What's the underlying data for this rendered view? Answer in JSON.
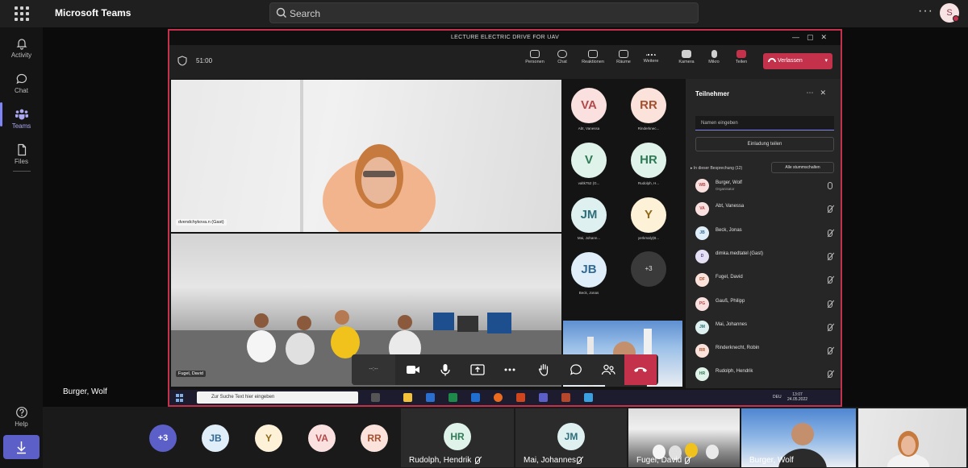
{
  "app": {
    "title": "Microsoft Teams"
  },
  "search": {
    "placeholder": "Search"
  },
  "user": {
    "initial": "S"
  },
  "rail": {
    "items": [
      {
        "label": "Activity",
        "icon": "bell-icon"
      },
      {
        "label": "Chat",
        "icon": "chat-icon"
      },
      {
        "label": "Teams",
        "icon": "teams-icon"
      },
      {
        "label": "Files",
        "icon": "file-icon"
      }
    ],
    "help": "Help"
  },
  "stage": {
    "participant_name": "Burger, Wolf"
  },
  "shared_screen": {
    "window_title": "LECTURE ELECTRIC DRIVE FOR UAV",
    "timer": "51:00",
    "toolbar": [
      {
        "label": "Personen"
      },
      {
        "label": "Chat"
      },
      {
        "label": "Reaktionen"
      },
      {
        "label": "Räume"
      },
      {
        "label": "Weitere"
      },
      {
        "label": "Kamera"
      },
      {
        "label": "Mikro"
      },
      {
        "label": "Teilen"
      }
    ],
    "leave_label": "Verlassen",
    "tile1_name": "dvendchykova.n (Gast)",
    "tile2_name": "Fugel, David",
    "grid": [
      {
        "initials": "VA",
        "name": "Abt, Vanessa",
        "bg": "#fbe0e0",
        "fg": "#b34a4a"
      },
      {
        "initials": "RR",
        "name": "Rinderknec...",
        "bg": "#fbe3dc",
        "fg": "#a4502e"
      },
      {
        "initials": "V",
        "name": "valtk752 (G...",
        "bg": "#dff3ea",
        "fg": "#2e7a55"
      },
      {
        "initials": "HR",
        "name": "Rudolph, H...",
        "bg": "#dff3ea",
        "fg": "#2e7a55"
      },
      {
        "initials": "JM",
        "name": "Mai, Johann...",
        "bg": "#dff0f0",
        "fg": "#2d6e7a"
      },
      {
        "initials": "Y",
        "name": "yerkmaly(B...",
        "bg": "#fdf1d8",
        "fg": "#8f6a1a"
      },
      {
        "initials": "JB",
        "name": "Beck, Jonas",
        "bg": "#dfeef8",
        "fg": "#336a94"
      }
    ],
    "more_count": "+3",
    "panel": {
      "title": "Teilnehmer",
      "search_placeholder": "Namen eingeben",
      "invite_label": "Einladung teilen",
      "section_label": "In dieser Besprechung (12)",
      "mute_all_label": "Alle stummschalten",
      "participants": [
        {
          "initials": "WB",
          "name": "Burger, Wolf",
          "sub": "Organisator",
          "bg": "#fbe0e0",
          "fg": "#b34a4a",
          "mic": "on"
        },
        {
          "initials": "VA",
          "name": "Abt, Vanessa",
          "sub": "",
          "bg": "#fbe0e0",
          "fg": "#b34a4a",
          "mic": "off"
        },
        {
          "initials": "JB",
          "name": "Beck, Jonas",
          "sub": "",
          "bg": "#dfeef8",
          "fg": "#336a94",
          "mic": "off"
        },
        {
          "initials": "D",
          "name": "dimka.medtatel (Gast)",
          "sub": "",
          "bg": "#e6e0f5",
          "fg": "#5a4a94",
          "mic": "off"
        },
        {
          "initials": "DF",
          "name": "Fugel, David",
          "sub": "",
          "bg": "#fbe3dc",
          "fg": "#a4502e",
          "mic": "off"
        },
        {
          "initials": "PG",
          "name": "Gauß, Philipp",
          "sub": "",
          "bg": "#fbe0e0",
          "fg": "#b34a4a",
          "mic": "off"
        },
        {
          "initials": "JM",
          "name": "Mai, Johannes",
          "sub": "",
          "bg": "#dff0f0",
          "fg": "#2d6e7a",
          "mic": "off"
        },
        {
          "initials": "RR",
          "name": "Rinderknecht, Robin",
          "sub": "",
          "bg": "#fbe3dc",
          "fg": "#a4502e",
          "mic": "off"
        },
        {
          "initials": "HR",
          "name": "Rudolph, Hendrik",
          "sub": "",
          "bg": "#dff3ea",
          "fg": "#2e7a55",
          "mic": "off"
        }
      ]
    },
    "callbar_timer": "--:--",
    "taskbar": {
      "search_placeholder": "Zur Suche Text hier eingeben",
      "lang": "DEU",
      "time": "13:07",
      "date": "24.05.2022"
    }
  },
  "strip": {
    "more_count": "+3",
    "avatars": [
      {
        "initials": "JB",
        "bg": "#dfeef8",
        "fg": "#336a94"
      },
      {
        "initials": "Y",
        "bg": "#fdf1d8",
        "fg": "#8f6a1a"
      },
      {
        "initials": "VA",
        "bg": "#fbe0e0",
        "fg": "#b34a4a"
      },
      {
        "initials": "RR",
        "bg": "#fbe3dc",
        "fg": "#a4502e"
      }
    ],
    "tiles": [
      {
        "initials": "HR",
        "name": "Rudolph, Hendrik",
        "bg": "#dff3ea",
        "fg": "#2e7a55"
      },
      {
        "initials": "JM",
        "name": "Mai, Johannes",
        "bg": "#dff0f0",
        "fg": "#2d6e7a"
      },
      {
        "name": "Fugel, David"
      },
      {
        "name": "Burger, Wolf"
      },
      {
        "name": ""
      }
    ]
  }
}
